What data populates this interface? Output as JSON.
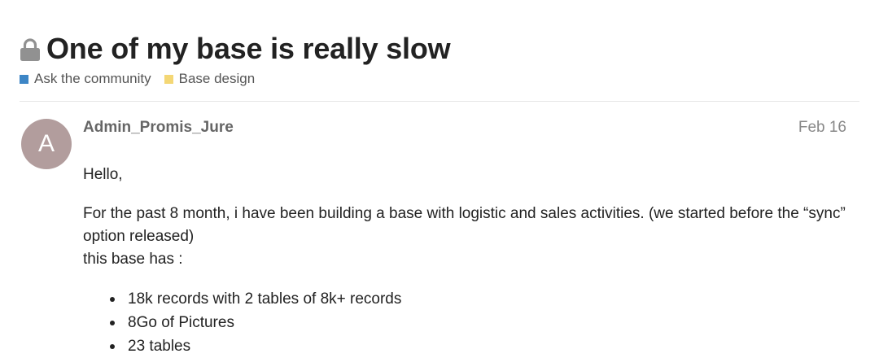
{
  "topic": {
    "title": "One of my base is really slow",
    "locked_icon": "lock-icon",
    "categories": [
      {
        "label": "Ask the community",
        "color": "#3d86c6"
      },
      {
        "label": "Base design",
        "color": "#f4d775"
      }
    ]
  },
  "post": {
    "avatar_letter": "A",
    "avatar_color": "#b29d9d",
    "username": "Admin_Promis_Jure",
    "date": "Feb 16",
    "greeting": "Hello,",
    "paragraph": "For the past 8 month, i have been building a base with logistic and sales activities. (we started before the “sync” option released)",
    "intro_line": "this base has :",
    "bullets": [
      "18k records with 2 tables of 8k+ records",
      "8Go of Pictures",
      "23 tables"
    ]
  },
  "colors": {
    "title": "#222222",
    "muted": "#666666",
    "date": "#888888",
    "divider": "#e6e6e6",
    "lock": "#919191"
  }
}
